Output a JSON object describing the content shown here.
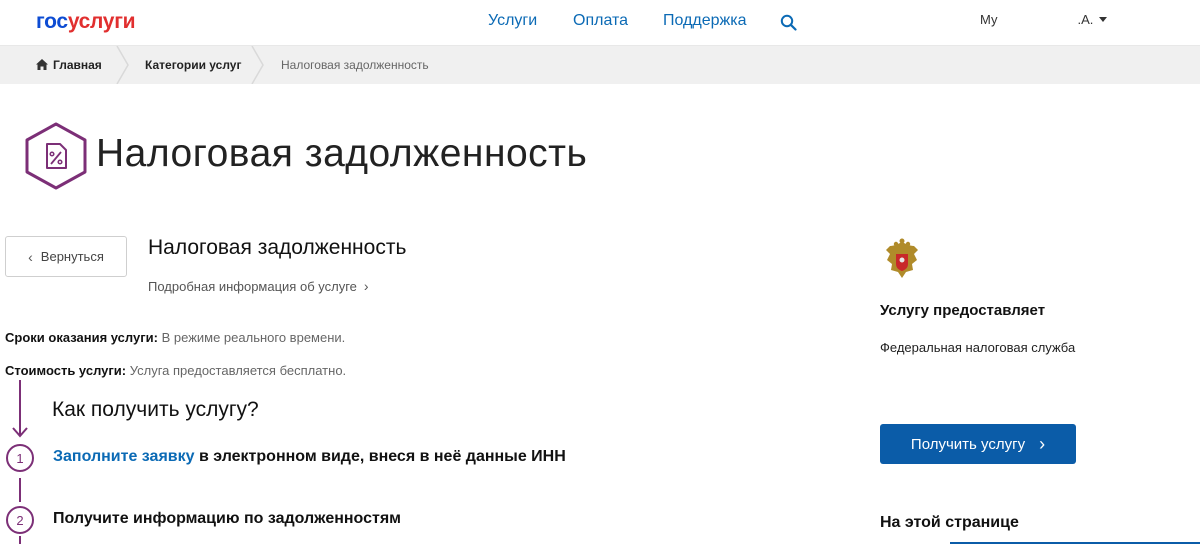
{
  "header": {
    "logo_part1": "гос",
    "logo_part2": "услуги",
    "nav": [
      "Услуги",
      "Оплата",
      "Поддержка"
    ],
    "user_label": "Му",
    "user_initials": ".А."
  },
  "breadcrumb": {
    "home": "Главная",
    "categories": "Категории услуг",
    "current": "Налоговая задолженность"
  },
  "page_title": "Налоговая задолженность",
  "main": {
    "back_label": "Вернуться",
    "service_heading": "Налоговая задолженность",
    "details_link": "Подробная информация об услуге",
    "terms_label": "Сроки оказания услуги:",
    "terms_value": "В режиме реального времени.",
    "cost_label": "Стоимость услуги:",
    "cost_value": "Услуга предоставляется бесплатно.",
    "steps_heading": "Как получить услугу?",
    "steps": [
      {
        "number": "1",
        "link": "Заполните заявку",
        "text": " в электронном виде, внеся в неё данные ИНН"
      },
      {
        "number": "2",
        "link": "",
        "text": "Получите информацию по задолженностям"
      }
    ]
  },
  "sidebar": {
    "provider_heading": "Услугу предоставляет",
    "provider_name": "Федеральная налоговая служба",
    "get_service_label": "Получить услугу",
    "on_page_heading": "На этой странице"
  },
  "colors": {
    "brand_blue": "#0d4cd3",
    "brand_red": "#e12f2f",
    "link": "#0b6ab5",
    "button": "#0b5ca8",
    "accent_purple": "#7c2f77"
  }
}
